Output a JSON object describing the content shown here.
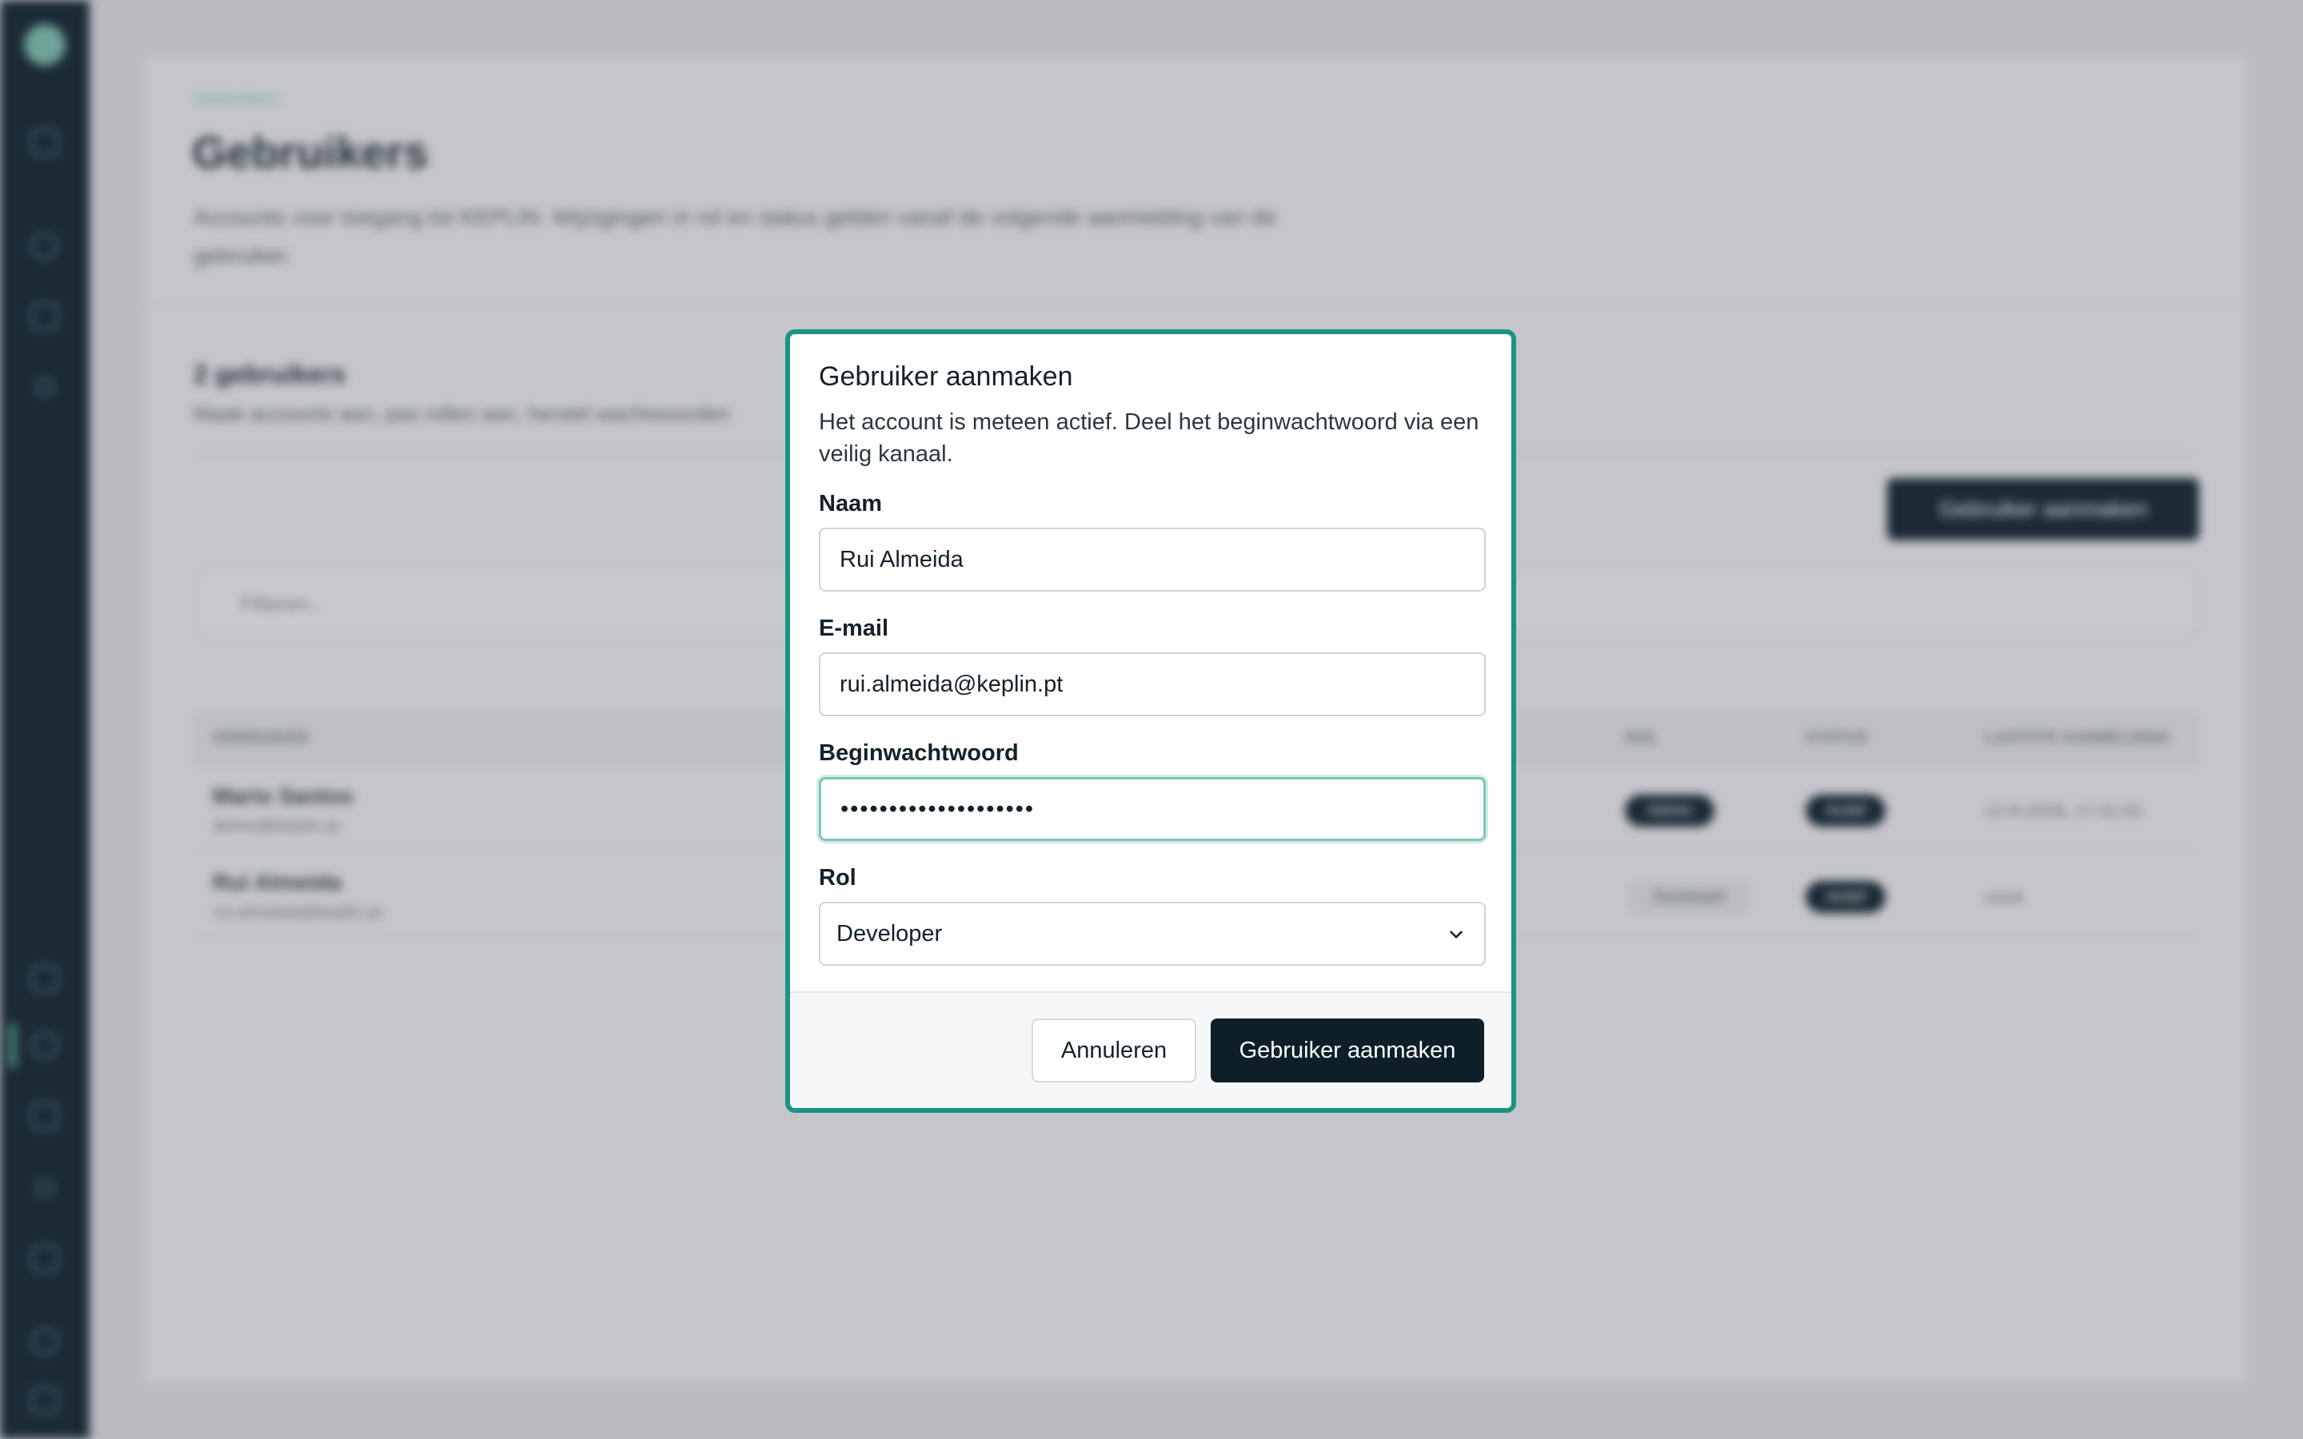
{
  "background": {
    "breadcrumb": "Gebruikers",
    "page_title": "Gebruikers",
    "page_description": "Accounts voor toegang tot KEPLIN. Wijzigingen in rol en status gelden vanaf de volgende aanmelding van de gebruiker.",
    "user_count": "2 gebruikers",
    "user_count_subtitle": "Maak accounts aan, pas rollen aan, herstel wachtwoorden",
    "create_button_label": "Gebruiker aanmaken",
    "filter_placeholder": "Filteren...",
    "table": {
      "headers": [
        "GEBRUIKER",
        "ROL",
        "STATUS",
        "LAATSTE AANMELDING"
      ],
      "rows": [
        {
          "name": "Mario Santos",
          "email": "demo@keplin.pt",
          "role": "Admin",
          "status": "Actief",
          "last_login": "12-8-2026, 17:41:01"
        },
        {
          "name": "Rui Almeida",
          "email": "rui.almeida@keplin.pt",
          "role": "Developer",
          "status": "Actief",
          "last_login": "nooit"
        }
      ]
    }
  },
  "modal": {
    "title": "Gebruiker aanmaken",
    "description": "Het account is meteen actief. Deel het beginwachtwoord via een veilig kanaal.",
    "fields": {
      "name": {
        "label": "Naam",
        "value": "Rui Almeida"
      },
      "email": {
        "label": "E-mail",
        "value": "rui.almeida@keplin.pt"
      },
      "password": {
        "label": "Beginwachtwoord",
        "value": "••••••••••••••••••••"
      },
      "role": {
        "label": "Rol",
        "value": "Developer"
      }
    },
    "cancel_label": "Annuleren",
    "submit_label": "Gebruiker aanmaken"
  },
  "colors": {
    "modal_border": "#1b9385",
    "primary_button": "#0e1f2a",
    "sidebar": "#0e1f2a"
  }
}
